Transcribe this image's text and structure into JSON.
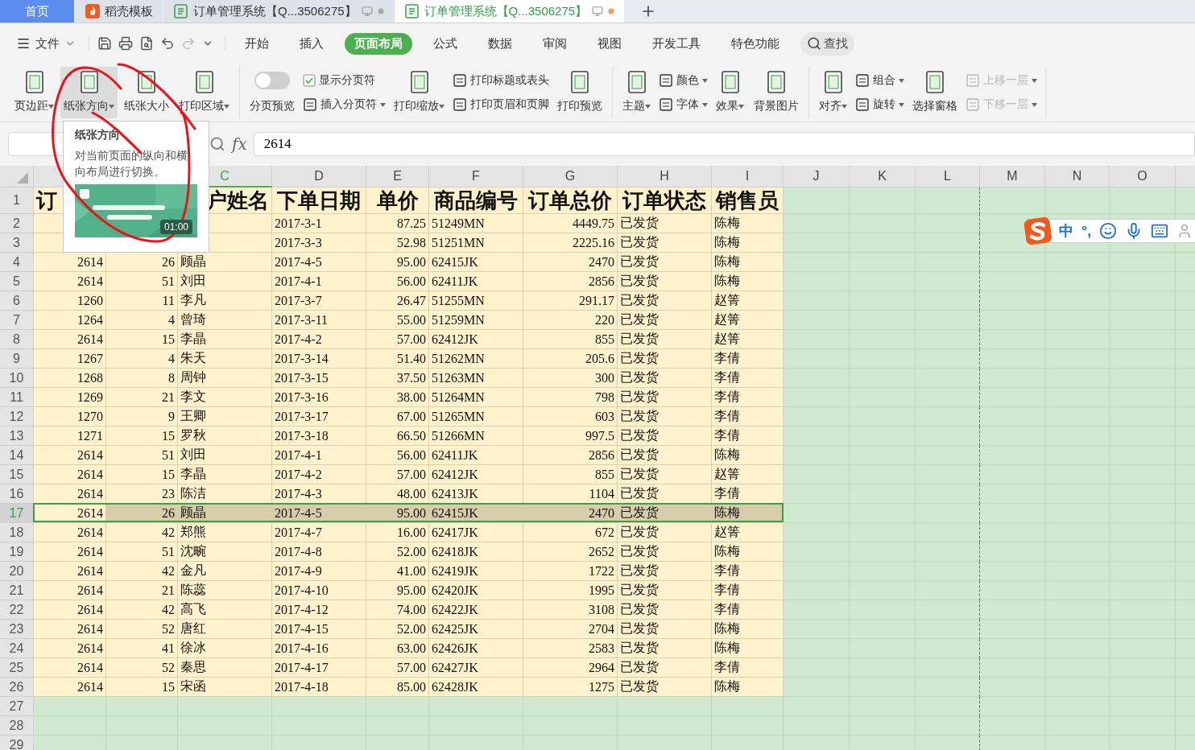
{
  "tabs": [
    {
      "label": "首页",
      "kind": "home",
      "selected": false
    },
    {
      "label": "稻壳模板",
      "kind": "docer",
      "selected": false
    },
    {
      "label": "订单管理系统【Q...3506275】",
      "kind": "doc",
      "selected": false
    },
    {
      "label": "订单管理系统【Q...3506275】",
      "kind": "doc",
      "selected": true
    }
  ],
  "menu": {
    "file": "文件",
    "items": [
      {
        "label": "开始",
        "selected": false
      },
      {
        "label": "插入",
        "selected": false
      },
      {
        "label": "页面布局",
        "selected": true
      },
      {
        "label": "公式",
        "selected": false
      },
      {
        "label": "数据",
        "selected": false
      },
      {
        "label": "审阅",
        "selected": false
      },
      {
        "label": "视图",
        "selected": false
      },
      {
        "label": "开发工具",
        "selected": false
      },
      {
        "label": "特色功能",
        "selected": false
      }
    ],
    "search": "查找"
  },
  "ribbon": [
    {
      "items": [
        {
          "kind": "large",
          "label": "页边距",
          "dropdown": true,
          "hovered": false
        },
        {
          "kind": "large",
          "label": "纸张方向",
          "dropdown": true,
          "hovered": true
        },
        {
          "kind": "large",
          "label": "纸张大小",
          "dropdown": false,
          "hovered": false
        },
        {
          "kind": "large",
          "label": "打印区域",
          "dropdown": true,
          "hovered": false
        }
      ]
    },
    {
      "items": [
        {
          "kind": "toggle",
          "label": "分页预览",
          "on": false
        },
        {
          "kind": "stack",
          "items": [
            {
              "kind": "check",
              "label": "显示分页符",
              "checked": true
            },
            {
              "kind": "small",
              "label": "插入分页符",
              "dropdown": true,
              "disabled": false
            }
          ]
        },
        {
          "kind": "large",
          "label": "打印缩放",
          "dropdown": true,
          "hovered": false
        },
        {
          "kind": "stack",
          "items": [
            {
              "kind": "small",
              "label": "打印标题或表头",
              "dropdown": false,
              "disabled": false
            },
            {
              "kind": "small",
              "label": "打印页眉和页脚",
              "dropdown": false,
              "disabled": false
            }
          ]
        },
        {
          "kind": "large",
          "label": "打印预览",
          "dropdown": false,
          "hovered": false
        }
      ]
    },
    {
      "items": [
        {
          "kind": "large",
          "label": "主题",
          "dropdown": true,
          "hovered": false
        },
        {
          "kind": "stack",
          "items": [
            {
              "kind": "small",
              "label": "颜色",
              "dropdown": true,
              "disabled": false
            },
            {
              "kind": "small",
              "label": "字体",
              "dropdown": true,
              "disabled": false
            }
          ]
        },
        {
          "kind": "large",
          "label": "效果",
          "dropdown": true,
          "hovered": false
        },
        {
          "kind": "large",
          "label": "背景图片",
          "dropdown": false,
          "hovered": false
        }
      ]
    },
    {
      "items": [
        {
          "kind": "large",
          "label": "对齐",
          "dropdown": true,
          "hovered": false
        },
        {
          "kind": "stack",
          "items": [
            {
              "kind": "small",
              "label": "组合",
              "dropdown": true,
              "disabled": false
            },
            {
              "kind": "small",
              "label": "旋转",
              "dropdown": true,
              "disabled": false
            }
          ]
        },
        {
          "kind": "large",
          "label": "选择窗格",
          "dropdown": false,
          "hovered": false
        },
        {
          "kind": "stack",
          "items": [
            {
              "kind": "small",
              "label": "上移一层",
              "dropdown": true,
              "disabled": true
            },
            {
              "kind": "small",
              "label": "下移一层",
              "dropdown": true,
              "disabled": true
            }
          ]
        }
      ]
    }
  ],
  "formula_bar": {
    "fx": "fx",
    "value": "2614"
  },
  "tooltip": {
    "title": "纸张方向",
    "text": "对当前页面的纵向和横向布局进行切换。",
    "video": {
      "kind": "picture",
      "duration": "01:00"
    }
  },
  "ime": {
    "labels": [
      "中",
      "°,"
    ]
  },
  "columns": [
    {
      "label": "C",
      "selected": true
    },
    {
      "label": "D",
      "selected": false
    },
    {
      "label": "E",
      "selected": false
    },
    {
      "label": "F",
      "selected": false
    },
    {
      "label": "G",
      "selected": false
    },
    {
      "label": "H",
      "selected": false
    },
    {
      "label": "I",
      "selected": false
    },
    {
      "label": "J",
      "selected": false
    },
    {
      "label": "K",
      "selected": false
    },
    {
      "label": "L",
      "selected": false
    },
    {
      "label": "M",
      "selected": false
    },
    {
      "label": "N",
      "selected": false
    },
    {
      "label": "O",
      "selected": false
    }
  ],
  "rows": [
    {
      "number": "1",
      "selected": false,
      "cells": [
        "订",
        "",
        "户姓名",
        "下单日期",
        "单价",
        "商品编号",
        "订单总价",
        "订单状态",
        "销售员"
      ]
    },
    {
      "number": "2",
      "selected": false,
      "cells": [
        "",
        "",
        "",
        "2017-3-1",
        "87.25",
        "51249MN",
        "4449.75",
        "已发货",
        "陈梅"
      ]
    },
    {
      "number": "3",
      "selected": false,
      "cells": [
        "",
        "",
        "",
        "2017-3-3",
        "52.98",
        "51251MN",
        "2225.16",
        "已发货",
        "陈梅"
      ]
    },
    {
      "number": "4",
      "selected": false,
      "cells": [
        "2614",
        "26",
        "顾晶",
        "2017-4-5",
        "95.00",
        "62415JK",
        "2470",
        "已发货",
        "陈梅"
      ]
    },
    {
      "number": "5",
      "selected": false,
      "cells": [
        "2614",
        "51",
        "刘田",
        "2017-4-1",
        "56.00",
        "62411JK",
        "2856",
        "已发货",
        "陈梅"
      ]
    },
    {
      "number": "6",
      "selected": false,
      "cells": [
        "1260",
        "11",
        "李凡",
        "2017-3-7",
        "26.47",
        "51255MN",
        "291.17",
        "已发货",
        "赵箐"
      ]
    },
    {
      "number": "7",
      "selected": false,
      "cells": [
        "1264",
        "4",
        "曾琦",
        "2017-3-11",
        "55.00",
        "51259MN",
        "220",
        "已发货",
        "赵箐"
      ]
    },
    {
      "number": "8",
      "selected": false,
      "cells": [
        "2614",
        "15",
        "李晶",
        "2017-4-2",
        "57.00",
        "62412JK",
        "855",
        "已发货",
        "赵箐"
      ]
    },
    {
      "number": "9",
      "selected": false,
      "cells": [
        "1267",
        "4",
        "朱天",
        "2017-3-14",
        "51.40",
        "51262MN",
        "205.6",
        "已发货",
        "李倩"
      ]
    },
    {
      "number": "10",
      "selected": false,
      "cells": [
        "1268",
        "8",
        "周钟",
        "2017-3-15",
        "37.50",
        "51263MN",
        "300",
        "已发货",
        "李倩"
      ]
    },
    {
      "number": "11",
      "selected": false,
      "cells": [
        "1269",
        "21",
        "李文",
        "2017-3-16",
        "38.00",
        "51264MN",
        "798",
        "已发货",
        "李倩"
      ]
    },
    {
      "number": "12",
      "selected": false,
      "cells": [
        "1270",
        "9",
        "王卿",
        "2017-3-17",
        "67.00",
        "51265MN",
        "603",
        "已发货",
        "李倩"
      ]
    },
    {
      "number": "13",
      "selected": false,
      "cells": [
        "1271",
        "15",
        "罗秋",
        "2017-3-18",
        "66.50",
        "51266MN",
        "997.5",
        "已发货",
        "李倩"
      ]
    },
    {
      "number": "14",
      "selected": false,
      "cells": [
        "2614",
        "51",
        "刘田",
        "2017-4-1",
        "56.00",
        "62411JK",
        "2856",
        "已发货",
        "陈梅"
      ]
    },
    {
      "number": "15",
      "selected": false,
      "cells": [
        "2614",
        "15",
        "李晶",
        "2017-4-2",
        "57.00",
        "62412JK",
        "855",
        "已发货",
        "赵箐"
      ]
    },
    {
      "number": "16",
      "selected": false,
      "cells": [
        "2614",
        "23",
        "陈洁",
        "2017-4-3",
        "48.00",
        "62413JK",
        "1104",
        "已发货",
        "李倩"
      ]
    },
    {
      "number": "17",
      "selected": true,
      "cells": [
        "2614",
        "26",
        "顾晶",
        "2017-4-5",
        "95.00",
        "62415JK",
        "2470",
        "已发货",
        "陈梅"
      ]
    },
    {
      "number": "18",
      "selected": false,
      "cells": [
        "2614",
        "42",
        "郑熊",
        "2017-4-7",
        "16.00",
        "62417JK",
        "672",
        "已发货",
        "赵箐"
      ]
    },
    {
      "number": "19",
      "selected": false,
      "cells": [
        "2614",
        "51",
        "沈畹",
        "2017-4-8",
        "52.00",
        "62418JK",
        "2652",
        "已发货",
        "陈梅"
      ]
    },
    {
      "number": "20",
      "selected": false,
      "cells": [
        "2614",
        "42",
        "金凡",
        "2017-4-9",
        "41.00",
        "62419JK",
        "1722",
        "已发货",
        "李倩"
      ]
    },
    {
      "number": "21",
      "selected": false,
      "cells": [
        "2614",
        "21",
        "陈蕊",
        "2017-4-10",
        "95.00",
        "62420JK",
        "1995",
        "已发货",
        "李倩"
      ]
    },
    {
      "number": "22",
      "selected": false,
      "cells": [
        "2614",
        "42",
        "高飞",
        "2017-4-12",
        "74.00",
        "62422JK",
        "3108",
        "已发货",
        "李倩"
      ]
    },
    {
      "number": "23",
      "selected": false,
      "cells": [
        "2614",
        "52",
        "唐红",
        "2017-4-15",
        "52.00",
        "62425JK",
        "2704",
        "已发货",
        "陈梅"
      ]
    },
    {
      "number": "24",
      "selected": false,
      "cells": [
        "2614",
        "41",
        "徐冰",
        "2017-4-16",
        "63.00",
        "62426JK",
        "2583",
        "已发货",
        "陈梅"
      ]
    },
    {
      "number": "25",
      "selected": false,
      "cells": [
        "2614",
        "52",
        "秦思",
        "2017-4-17",
        "57.00",
        "62427JK",
        "2964",
        "已发货",
        "李倩"
      ]
    },
    {
      "number": "26",
      "selected": false,
      "cells": [
        "2614",
        "15",
        "宋函",
        "2017-4-18",
        "85.00",
        "62428JK",
        "1275",
        "已发货",
        "陈梅"
      ]
    },
    {
      "number": "27",
      "selected": false,
      "cells": []
    },
    {
      "number": "28",
      "selected": false,
      "cells": []
    },
    {
      "number": "29",
      "selected": false,
      "cells": []
    }
  ]
}
